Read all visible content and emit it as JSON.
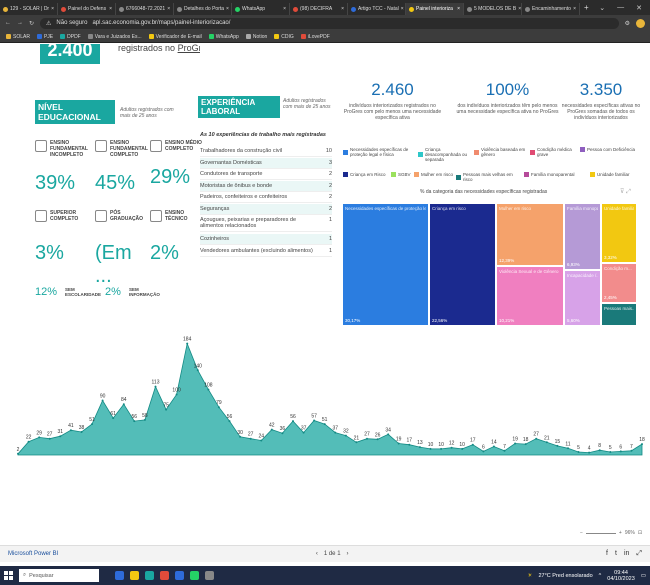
{
  "browser": {
    "tabs": [
      {
        "label": "129 - SOLAR | Dr",
        "color": "#e8b53a"
      },
      {
        "label": "Painel do Defens",
        "color": "#e04b3a"
      },
      {
        "label": "6766048-72.2021",
        "color": "#888"
      },
      {
        "label": "Detalhes do Porta",
        "color": "#888"
      },
      {
        "label": "WhatsApp",
        "color": "#25d366"
      },
      {
        "label": "(98) DECIFRA",
        "color": "#e04b3a"
      },
      {
        "label": "Artigo TCC - Natal",
        "color": "#2e6bd9"
      },
      {
        "label": "Painel interioriza",
        "color": "#f2c811",
        "active": true
      },
      {
        "label": "5 MODELOS DE B",
        "color": "#888"
      },
      {
        "label": "Encaminhamento",
        "color": "#888"
      }
    ],
    "new_tab": "+",
    "address": "Não seguro",
    "url": "apl.sac.economia.gov.br/maps/painel-interiorizacao/",
    "bookmarks": [
      {
        "label": "SOLAR",
        "color": "#e8b53a"
      },
      {
        "label": "PJE",
        "color": "#2e6bd9"
      },
      {
        "label": "DPDF",
        "color": "#1aa7a0"
      },
      {
        "label": "Vara e Juizados Es...",
        "color": "#888"
      },
      {
        "label": "Verificador de E-mail",
        "color": "#f2c811"
      },
      {
        "label": "WhatsApp",
        "color": "#25d366"
      },
      {
        "label": "Notion",
        "color": "#aaa"
      },
      {
        "label": "CDIG",
        "color": "#f2c811"
      },
      {
        "label": "iLovePDF",
        "color": "#e04b3a"
      }
    ]
  },
  "report": {
    "top_left_value": "2.400",
    "top_left_text": "registrados no",
    "top_left_link": "ProGres V4",
    "edu": {
      "title": "NÍVEL EDUCACIONAL",
      "note": "Adultos registrados com mais de 25 anos",
      "items": [
        {
          "label": "ENSINO FUNDAMENTAL INCOMPLETO",
          "value": "39%"
        },
        {
          "label": "ENSINO FUNDAMENTAL COMPLETO",
          "value": "45%"
        },
        {
          "label": "ENSINO MÉDIO COMPLETO",
          "value": "29%"
        },
        {
          "label": "SUPERIOR COMPLETO",
          "value": "3%"
        },
        {
          "label": "PÓS GRADUAÇÃO",
          "value": "(Em ..."
        },
        {
          "label": "ENSINO TÉCNICO",
          "value": "2%"
        }
      ],
      "footer": [
        {
          "value": "12%",
          "label": "SEM ESCOLARIDADE"
        },
        {
          "value": "2%",
          "label": "SEM INFORMAÇÃO"
        }
      ]
    },
    "exp": {
      "title": "EXPERIÊNCIA LABORAL",
      "note": "Adultos registrados com mais de 25 anos",
      "subtitle": "As 10 experiências de trabalho mais registradas",
      "rows": [
        {
          "label": "Trabalhadores da construção civil",
          "value": "10"
        },
        {
          "label": "Governantas Domésticas",
          "value": "3"
        },
        {
          "label": "Condutores de transporte",
          "value": "2"
        },
        {
          "label": "Motoristas de ônibus e bonde",
          "value": "2"
        },
        {
          "label": "Padeiros, confeiteiros e confeiteiros",
          "value": "2"
        },
        {
          "label": "Seguranças",
          "value": "2"
        },
        {
          "label": "Açougues, peixarias e preparadores de alimentos relacionados",
          "value": "1"
        },
        {
          "label": "Cozinheiros",
          "value": "1"
        },
        {
          "label": "Vendedores ambulantes (excluindo alimentos)",
          "value": "1"
        }
      ]
    },
    "kpis": [
      {
        "value": "2.460",
        "text": "indivíduos interiorizados registrados no ProGres com pelo menos uma necessidade específica ativa"
      },
      {
        "value": "100%",
        "text": "dos indivíduos interiorizados têm pelo menos uma necessidade específica ativa no ProGres"
      },
      {
        "value": "3.350",
        "text": "necessidades específicas ativas no ProGres somadas de todos os indivíduos interiorizados"
      }
    ],
    "legend": [
      {
        "label": "Necessidades específicas de proteção legal e física",
        "color": "#2b7de0"
      },
      {
        "label": "Criança desacompanhada ou separada",
        "color": "#2ec7c9"
      },
      {
        "label": "Violência baseada em gênero",
        "color": "#f08b6e"
      },
      {
        "label": "Condição médica grave",
        "color": "#e04b73"
      },
      {
        "label": "Pessoa com Deficiência",
        "color": "#8f5fbf"
      },
      {
        "label": "Criança em Risco",
        "color": "#1b2a8f"
      },
      {
        "label": "SGBV",
        "color": "#9be15d"
      },
      {
        "label": "Mulher em risco",
        "color": "#f5a26b"
      },
      {
        "label": "Pessoas mais velhas em risco",
        "color": "#1a7a7a"
      },
      {
        "label": "Família monoparental",
        "color": "#b64a9a"
      },
      {
        "label": "Unidade familiar",
        "color": "#f2c811"
      }
    ],
    "treemap_title": "% da categoria das necessidades específicas registradas",
    "treemap": [
      {
        "label": "Necessidades específicas de proteção legal...",
        "value": "30,17%",
        "color": "#2b7de0"
      },
      {
        "label": "Criança em risco",
        "value": "22,56%",
        "color": "#1b2a8f"
      },
      {
        "label": "Mulher em risco",
        "value": "12,39%",
        "color": "#f5a26b"
      },
      {
        "label": "Violência Sexual e de Gênero",
        "value": "10,21%",
        "color": "#f07fc0"
      },
      {
        "label": "Família monopa...",
        "value": "6,93%",
        "color": "#b59ad6"
      },
      {
        "label": "Incapacidade /...",
        "value": "5,60%",
        "color": "#d7a2e8"
      },
      {
        "label": "Unidade familiar",
        "value": "3,32%",
        "color": "#f2c811"
      },
      {
        "label": "Condição m...",
        "value": "2,45%",
        "color": "#f28c8c"
      },
      {
        "label": "Pessoas mais...",
        "value": "",
        "color": "#1a7a7a"
      }
    ]
  },
  "chart_data": {
    "type": "area",
    "color": "#1aa7a0",
    "values": [
      2,
      22,
      29,
      27,
      31,
      41,
      38,
      51,
      90,
      61,
      84,
      56,
      58,
      113,
      75,
      100,
      184,
      140,
      108,
      79,
      56,
      30,
      27,
      24,
      42,
      36,
      56,
      37,
      57,
      51,
      37,
      32,
      21,
      27,
      26,
      34,
      19,
      17,
      13,
      10,
      10,
      12,
      10,
      17,
      6,
      14,
      7,
      19,
      18,
      27,
      21,
      15,
      11,
      5,
      4,
      8,
      5,
      6,
      7,
      18
    ]
  },
  "footer": {
    "pbi_label": "Microsoft Power BI",
    "page": "1 de 1",
    "zoom": "96%"
  },
  "taskbar": {
    "search": "Pesquisar",
    "weather": "27°C Pred ensolarado",
    "time": "09:44",
    "date": "04/10/2023",
    "apps": [
      "#2e6bd9",
      "#f2c811",
      "#1aa7a0",
      "#e04b3a",
      "#2e6bd9",
      "#25d366",
      "#888"
    ]
  }
}
